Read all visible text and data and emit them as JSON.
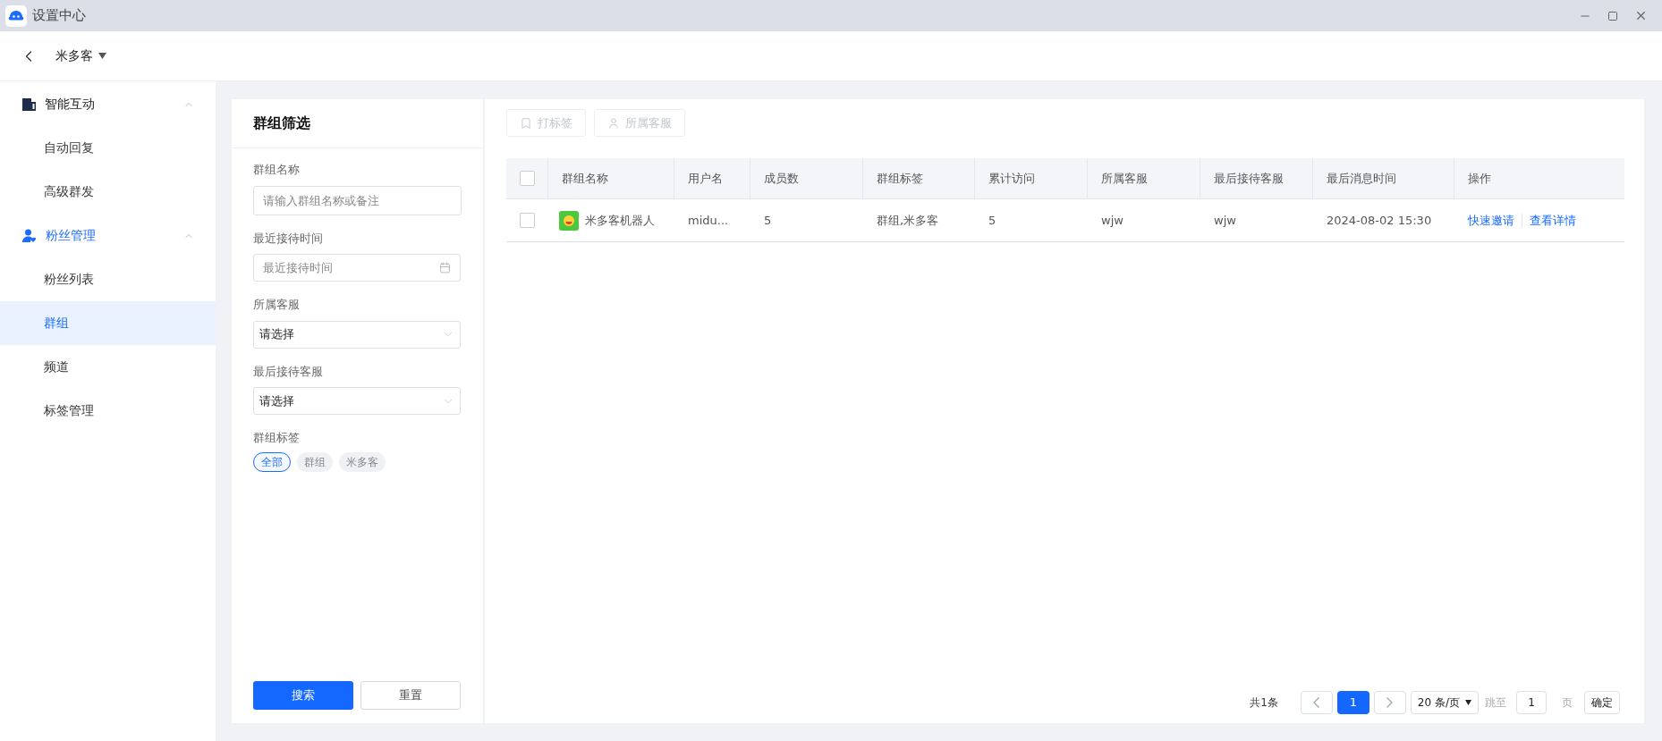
{
  "window": {
    "title": "设置中心"
  },
  "header": {
    "account": "米多客"
  },
  "sidebar": {
    "groups": [
      {
        "label": "智能互动",
        "kind": "building",
        "active": false,
        "expanded": true,
        "items": [
          {
            "label": "自动回复",
            "selected": false
          },
          {
            "label": "高级群发",
            "selected": false
          }
        ]
      },
      {
        "label": "粉丝管理",
        "kind": "user",
        "active": true,
        "expanded": true,
        "items": [
          {
            "label": "粉丝列表",
            "selected": false
          },
          {
            "label": "群组",
            "selected": true
          },
          {
            "label": "频道",
            "selected": false
          },
          {
            "label": "标签管理",
            "selected": false
          }
        ]
      }
    ]
  },
  "filter": {
    "title": "群组筛选",
    "fields": [
      {
        "kind": "text",
        "label": "群组名称",
        "placeholder": "请输入群组名称或备注"
      },
      {
        "kind": "date",
        "label": "最近接待时间",
        "placeholder": "最近接待时间"
      },
      {
        "kind": "select",
        "label": "所属客服",
        "value": "请选择"
      },
      {
        "kind": "select",
        "label": "最后接待客服",
        "value": "请选择"
      }
    ],
    "tags_label": "群组标签",
    "tags": [
      {
        "label": "全部",
        "selected": true
      },
      {
        "label": "群组",
        "selected": false
      },
      {
        "label": "米多客",
        "selected": false
      }
    ],
    "search_button": "搜索",
    "reset_button": "重置"
  },
  "toolbar": [
    {
      "label": "打标签",
      "kind": "bookmark",
      "disabled": true
    },
    {
      "label": "所属客服",
      "kind": "user",
      "disabled": true
    }
  ],
  "table": {
    "all_checked": false,
    "columns": [
      "群组名称",
      "用户名",
      "成员数",
      "群组标签",
      "累计访问",
      "所属客服",
      "最后接待客服",
      "最后消息时间",
      "操作"
    ],
    "rows": [
      {
        "checked": false,
        "cells": [
          "米多客机器人",
          "midu...",
          "5",
          "群组,米多客",
          "5",
          "wjw",
          "wjw",
          "2024-08-02 15:30"
        ],
        "actions": [
          "快速邀请",
          "查看详情"
        ]
      }
    ]
  },
  "pagination": {
    "total": "共1条",
    "pages": [
      {
        "label": "1",
        "selected": true
      }
    ],
    "page_size": "20 条/页",
    "jump_label": "跳至",
    "jump_value": "1",
    "page_unit": "页",
    "confirm": "确定"
  }
}
